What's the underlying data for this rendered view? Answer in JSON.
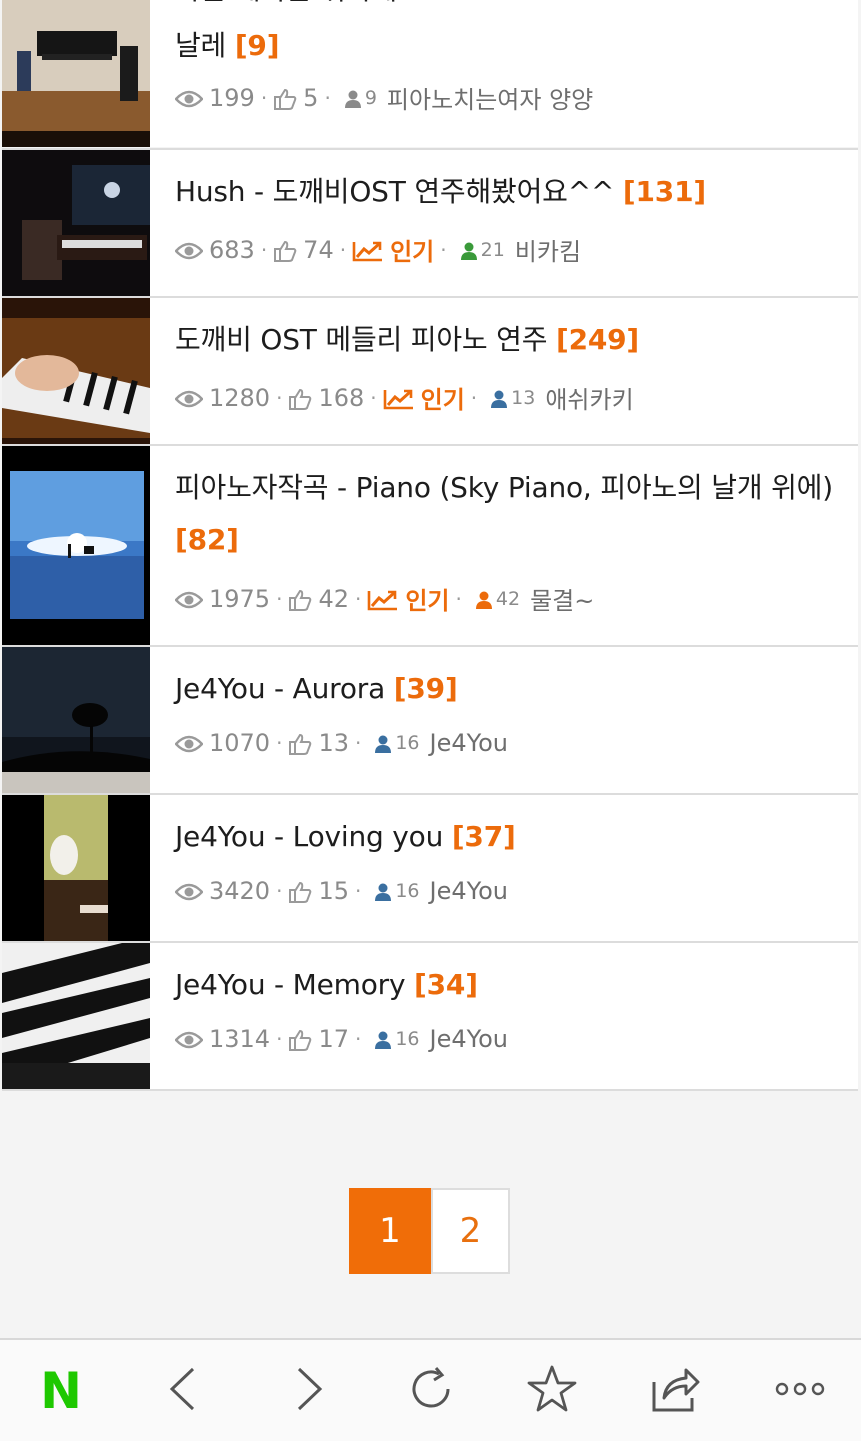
{
  "posts": [
    {
      "title": "날레",
      "comments": "[9]",
      "views": "199",
      "likes": "5",
      "hot": false,
      "author_count": "9",
      "author_color": "#8a8a8a",
      "author": "피아노치는여자 양양"
    },
    {
      "title": "Hush - 도깨비OST 연주해봤어요^^",
      "comments": "[131]",
      "views": "683",
      "likes": "74",
      "hot": true,
      "hot_label": "인기",
      "author_count": "21",
      "author_color": "#3a9a3a",
      "author": "비카킴"
    },
    {
      "title": "도깨비 OST 메들리 피아노 연주",
      "comments": "[249]",
      "views": "1280",
      "likes": "168",
      "hot": true,
      "hot_label": "인기",
      "author_count": "13",
      "author_color": "#3a6fa0",
      "author": "애쉬카키"
    },
    {
      "title": "피아노자작곡 - Piano (Sky Piano, 피아노의 날개 위에)",
      "comments": "[82]",
      "views": "1975",
      "likes": "42",
      "hot": true,
      "hot_label": "인기",
      "author_count": "42",
      "author_color": "#ec6b0b",
      "author": "물결~"
    },
    {
      "title": "Je4You - Aurora",
      "comments": "[39]",
      "views": "1070",
      "likes": "13",
      "hot": false,
      "author_count": "16",
      "author_color": "#3a6fa0",
      "author": "Je4You"
    },
    {
      "title": "Je4You - Loving you",
      "comments": "[37]",
      "views": "3420",
      "likes": "15",
      "hot": false,
      "author_count": "16",
      "author_color": "#3a6fa0",
      "author": "Je4You"
    },
    {
      "title": "Je4You - Memory",
      "comments": "[34]",
      "views": "1314",
      "likes": "17",
      "hot": false,
      "author_count": "16",
      "author_color": "#3a6fa0",
      "author": "Je4You"
    }
  ],
  "pagination": {
    "current": "1",
    "next": "2"
  },
  "toolbar": {
    "brand_letter": "N",
    "brand_color": "#1ec800"
  },
  "accent_color": "#ec6b0b"
}
